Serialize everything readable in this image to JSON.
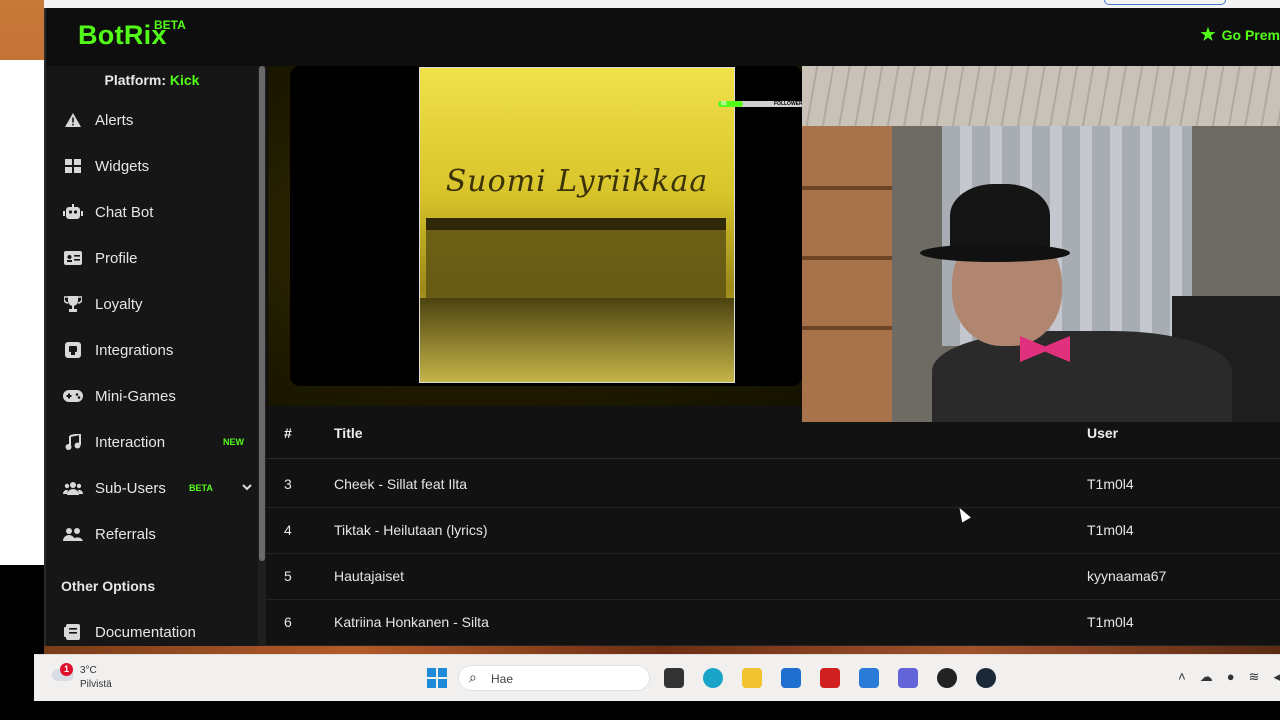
{
  "app": {
    "logo": "BotRix",
    "logo_badge": "BETA",
    "premium_label": "Go Prem"
  },
  "sidebar": {
    "platform_label": "Platform:",
    "platform_value": "Kick",
    "items": [
      {
        "label": "Alerts",
        "icon": "warning-icon"
      },
      {
        "label": "Widgets",
        "icon": "widgets-grid-icon"
      },
      {
        "label": "Chat Bot",
        "icon": "robot-icon"
      },
      {
        "label": "Profile",
        "icon": "id-card-icon"
      },
      {
        "label": "Loyalty",
        "icon": "trophy-icon"
      },
      {
        "label": "Integrations",
        "icon": "plug-icon"
      },
      {
        "label": "Mini-Games",
        "icon": "gamepad-icon"
      },
      {
        "label": "Interaction",
        "icon": "music-note-icon",
        "tag": "NEW"
      },
      {
        "label": "Sub-Users",
        "icon": "users-icon",
        "tag": "BETA"
      },
      {
        "label": "Referrals",
        "icon": "user-group-icon"
      }
    ],
    "other_options_title": "Other Options",
    "documentation_label": "Documentation"
  },
  "player": {
    "cover_title": "Suomi Lyriikkaa",
    "followers_label": "FOLLOWERS",
    "followers_current": "95",
    "followers_goal": "250"
  },
  "table": {
    "headers": {
      "num": "#",
      "title": "Title",
      "user": "User"
    },
    "rows": [
      {
        "num": "3",
        "title": "Cheek - Sillat feat Ilta",
        "user": "T1m0l4"
      },
      {
        "num": "4",
        "title": "Tiktak - Heilutaan (lyrics)",
        "user": "T1m0l4"
      },
      {
        "num": "5",
        "title": "Hautajaiset",
        "user": "kyynaama67"
      },
      {
        "num": "6",
        "title": "Katriina Honkanen - Silta",
        "user": "T1m0l4"
      }
    ]
  },
  "taskbar": {
    "notification_count": "1",
    "temperature": "3°C",
    "weather_text": "Pilvistä",
    "search_placeholder": "Hae"
  },
  "colors": {
    "accent": "#53fc18",
    "sidebar_bg": "#161616",
    "main_bg": "#121212"
  }
}
